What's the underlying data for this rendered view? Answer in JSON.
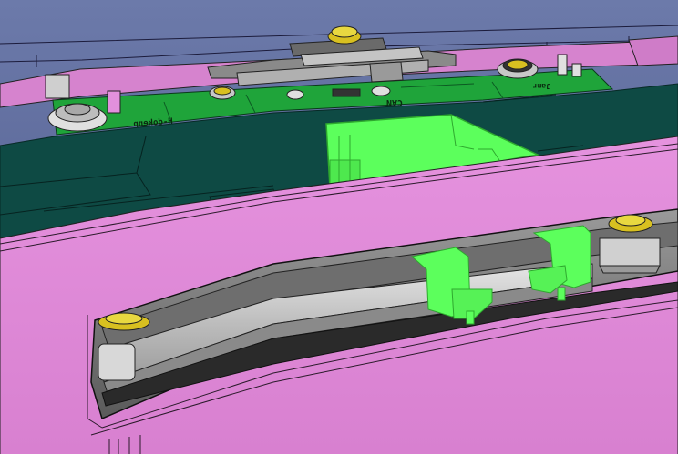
{
  "scene": {
    "view_title": "",
    "colors": {
      "background_top": "#6a78a8",
      "background_bottom": "#4a5588",
      "enclosure_pink": "#e08ad8",
      "enclosure_dark": "#b46aae",
      "pcb_green": "#21a23a",
      "pcb_dark": "#0f4a44",
      "highlight_green": "#5cff5c",
      "highlight_green_dark": "#34c634",
      "bolt_gold": "#d8c020",
      "metal_grey": "#c8c8c8",
      "metal_dark": "#8a8a8a"
    },
    "silkscreen": {
      "left_label": "H-dokenp",
      "center_label": "CAN",
      "right_label": "Jamr"
    }
  }
}
